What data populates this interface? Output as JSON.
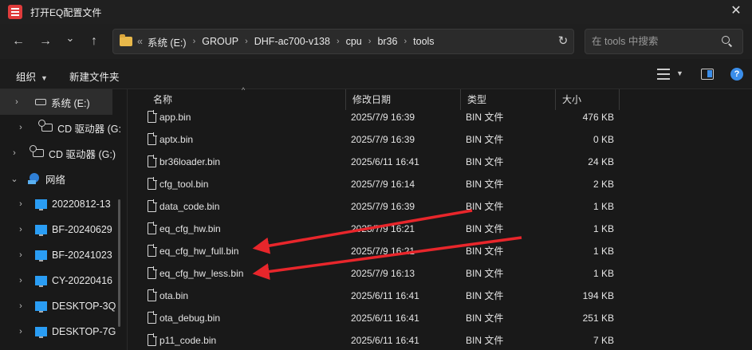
{
  "window": {
    "title": "打开EQ配置文件",
    "close": "✕"
  },
  "nav": {
    "back": "←",
    "forward": "→",
    "recent": "⌄",
    "up": "↑",
    "breadcrumb_lead": "«",
    "breadcrumbs": [
      "系统 (E:)",
      "GROUP",
      "DHF-ac700-v138",
      "cpu",
      "br36",
      "tools"
    ],
    "separator": "›",
    "refresh": "↻",
    "search_placeholder": "在 tools 中搜索"
  },
  "toolbar": {
    "organize": "组织",
    "organize_caret": "▼",
    "new_folder": "新建文件夹",
    "view_caret": "▼",
    "help": "?"
  },
  "sidebar": {
    "items": [
      {
        "label": "系统 (E:)",
        "icon": "drive-icon",
        "chevron": "›",
        "selected": true
      },
      {
        "label": "CD 驱动器 (G:",
        "icon": "cd-icon",
        "chevron": "›"
      },
      {
        "label": "CD 驱动器 (G:)",
        "icon": "cd-icon",
        "chevron": "›"
      },
      {
        "label": "网络",
        "icon": "network-icon",
        "chevron": "⌄"
      },
      {
        "label": "20220812-13",
        "icon": "computer-icon",
        "chevron": "›"
      },
      {
        "label": "BF-20240629",
        "icon": "computer-icon",
        "chevron": "›"
      },
      {
        "label": "BF-20241023",
        "icon": "computer-icon",
        "chevron": "›"
      },
      {
        "label": "CY-20220416",
        "icon": "computer-icon",
        "chevron": "›"
      },
      {
        "label": "DESKTOP-3Q",
        "icon": "computer-icon",
        "chevron": "›"
      },
      {
        "label": "DESKTOP-7G",
        "icon": "computer-icon",
        "chevron": "›"
      }
    ]
  },
  "columns": {
    "name": "名称",
    "modified": "修改日期",
    "type": "类型",
    "size": "大小",
    "sort_indicator": "^"
  },
  "files": [
    {
      "name": "app.bin",
      "modified": "2025/7/9 16:39",
      "type": "BIN 文件",
      "size": "476 KB"
    },
    {
      "name": "aptx.bin",
      "modified": "2025/7/9 16:39",
      "type": "BIN 文件",
      "size": "0 KB"
    },
    {
      "name": "br36loader.bin",
      "modified": "2025/6/11 16:41",
      "type": "BIN 文件",
      "size": "24 KB"
    },
    {
      "name": "cfg_tool.bin",
      "modified": "2025/7/9 16:14",
      "type": "BIN 文件",
      "size": "2 KB"
    },
    {
      "name": "data_code.bin",
      "modified": "2025/7/9 16:39",
      "type": "BIN 文件",
      "size": "1 KB"
    },
    {
      "name": "eq_cfg_hw.bin",
      "modified": "2025/7/9 16:21",
      "type": "BIN 文件",
      "size": "1 KB"
    },
    {
      "name": "eq_cfg_hw_full.bin",
      "modified": "2025/7/9 16:21",
      "type": "BIN 文件",
      "size": "1 KB"
    },
    {
      "name": "eq_cfg_hw_less.bin",
      "modified": "2025/7/9 16:13",
      "type": "BIN 文件",
      "size": "1 KB"
    },
    {
      "name": "ota.bin",
      "modified": "2025/6/11 16:41",
      "type": "BIN 文件",
      "size": "194 KB"
    },
    {
      "name": "ota_debug.bin",
      "modified": "2025/6/11 16:41",
      "type": "BIN 文件",
      "size": "251 KB"
    },
    {
      "name": "p11_code.bin",
      "modified": "2025/6/11 16:41",
      "type": "BIN 文件",
      "size": "7 KB"
    }
  ],
  "annotation": {
    "arrow_color": "#e8262b"
  }
}
